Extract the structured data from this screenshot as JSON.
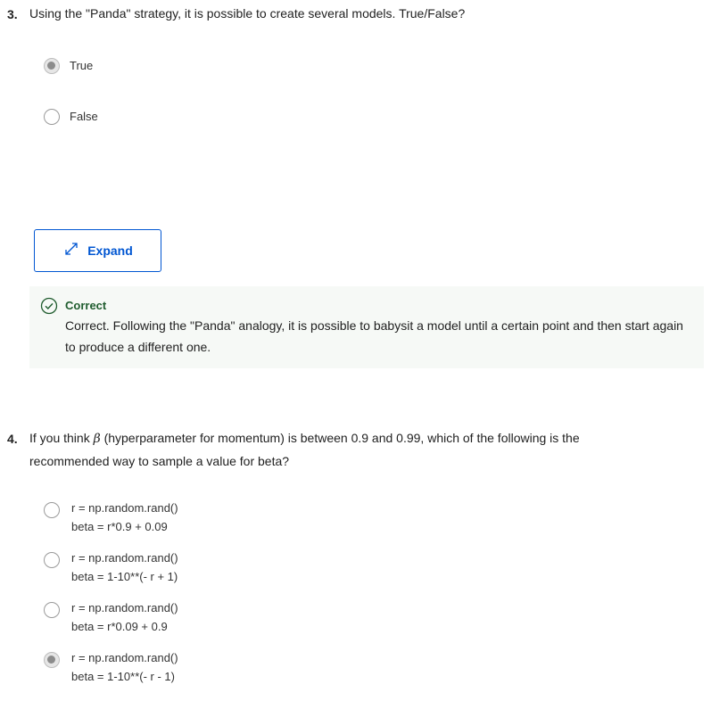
{
  "question3": {
    "number": "3.",
    "text": "Using the \"Panda\" strategy, it is possible to create several models. True/False?",
    "options": [
      {
        "label": "True",
        "selected": true
      },
      {
        "label": "False",
        "selected": false
      }
    ],
    "expand_button": {
      "label": "Expand",
      "icon": "expand-arrows-icon"
    },
    "feedback": {
      "status": "Correct",
      "icon": "check-circle-icon",
      "message": "Correct. Following the \"Panda\" analogy, it is possible to babysit a model until a certain point and then start again to produce a different one.",
      "status_color": "#1f5c2e"
    }
  },
  "question4": {
    "number": "4.",
    "text_before": "If you think ",
    "symbol": "β",
    "text_after": " (hyperparameter for momentum) is between 0.9 and 0.99, which of the following is the recommended way to sample a value for beta?",
    "options": [
      {
        "line1": "r = np.random.rand()",
        "line2": "beta = r*0.9 + 0.09",
        "selected": false
      },
      {
        "line1": "r = np.random.rand()",
        "line2": "beta = 1-10**(- r + 1)",
        "selected": false
      },
      {
        "line1": "r = np.random.rand()",
        "line2": "beta = r*0.09 + 0.9",
        "selected": false
      },
      {
        "line1": "r = np.random.rand()",
        "line2": "beta = 1-10**(- r - 1)",
        "selected": true
      }
    ]
  },
  "colors": {
    "accent": "#0056d2",
    "feedback_bg": "#f6f9f6",
    "success": "#1f5c2e"
  }
}
